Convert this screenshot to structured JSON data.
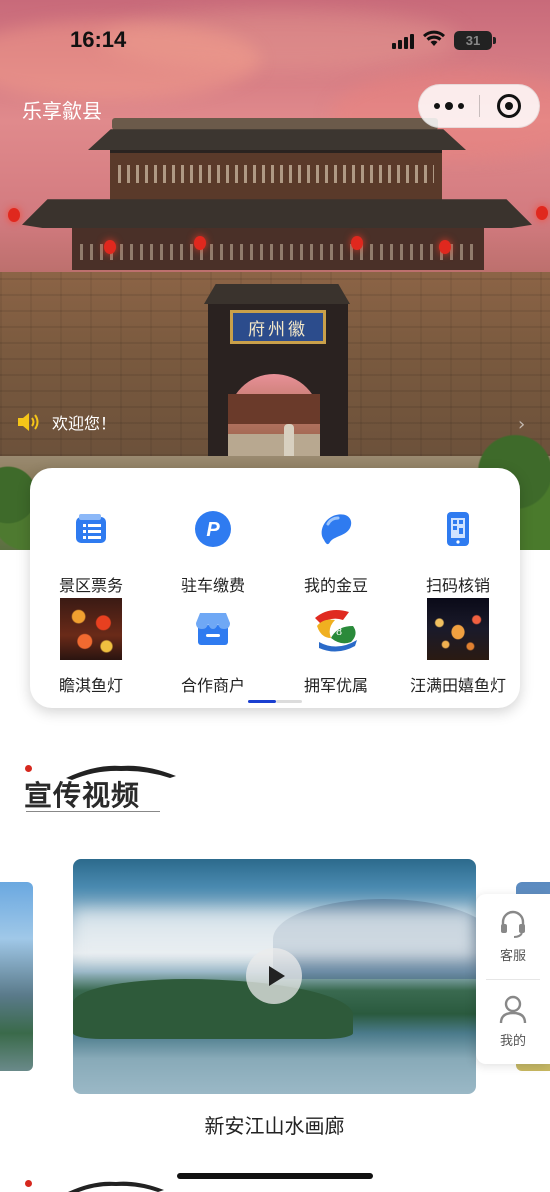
{
  "status_bar": {
    "time": "16:14",
    "battery": "31"
  },
  "header": {
    "title": "乐享歙县"
  },
  "hero": {
    "plaque_text": "府州徽"
  },
  "notice": {
    "text": "欢迎您！"
  },
  "menu": {
    "items": [
      {
        "label": "景区票务",
        "icon": "ticket-list-icon"
      },
      {
        "label": "驻车缴费",
        "icon": "parking-icon"
      },
      {
        "label": "我的金豆",
        "icon": "bean-icon"
      },
      {
        "label": "扫码核销",
        "icon": "scan-phone-icon"
      },
      {
        "label": "瞻淇鱼灯",
        "icon": "fish-lantern-photo"
      },
      {
        "label": "合作商户",
        "icon": "store-icon"
      },
      {
        "label": "拥军优属",
        "icon": "military-support-logo"
      },
      {
        "label": "汪满田嬉鱼灯",
        "icon": "night-festival-photo"
      }
    ]
  },
  "section": {
    "title": "宣传视频"
  },
  "video": {
    "caption": "新安江山水画廊"
  },
  "float": {
    "service_label": "客服",
    "mine_label": "我的"
  },
  "colors": {
    "accent_blue": "#1a3fd0",
    "icon_blue": "#2f7bf0",
    "red_dot": "#d6281e"
  }
}
